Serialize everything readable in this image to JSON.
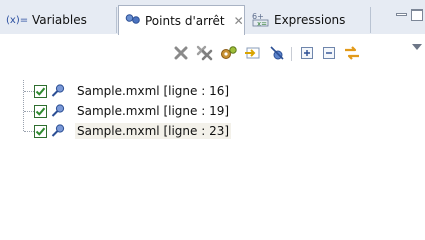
{
  "tabs": [
    {
      "label": "Variables",
      "icon": "variables-icon"
    },
    {
      "label": "Points d'arrêt",
      "icon": "breakpoints-icon",
      "active": true,
      "close_glyph": "✕"
    },
    {
      "label": "Expressions",
      "icon": "expressions-icon"
    }
  ],
  "toolbar": {
    "buttons": [
      "remove-breakpoint-icon",
      "remove-all-breakpoints-icon",
      "show-breakpoints-supported-icon",
      "go-to-file-icon",
      "skip-all-breakpoints-icon",
      "expand-all-icon",
      "collapse-all-icon",
      "link-with-debug-view-icon",
      "view-menu-icon"
    ]
  },
  "breakpoints": [
    {
      "label": "Sample.mxml [ligne : 16]",
      "checked": true
    },
    {
      "label": "Sample.mxml [ligne : 19]",
      "checked": true
    },
    {
      "label": "Sample.mxml [ligne : 23]",
      "checked": true,
      "selected": true
    }
  ],
  "colors": {
    "tabstrip_bg": "#e6ebf3",
    "check_green": "#2f8a2f",
    "selection_bg": "#f3f1ea"
  }
}
